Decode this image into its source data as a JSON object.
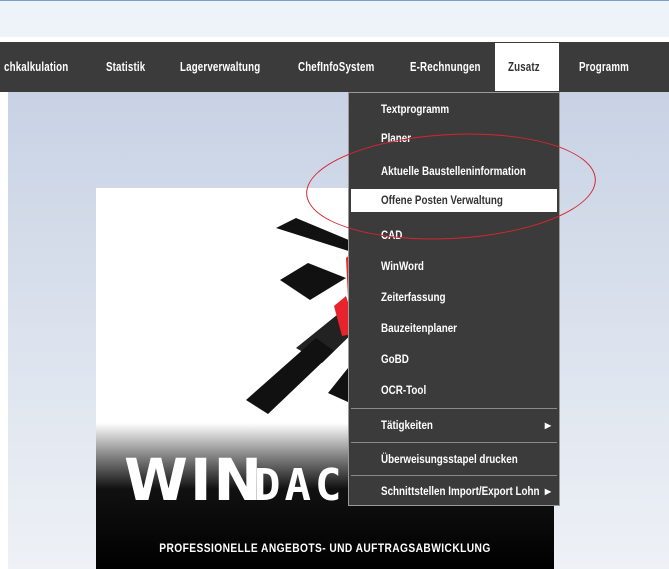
{
  "menubar": {
    "items": [
      {
        "label": "chkalkulation"
      },
      {
        "label": "Statistik"
      },
      {
        "label": "Lagerverwaltung"
      },
      {
        "label": "ChefInfoSystem"
      },
      {
        "label": "E-Rechnungen"
      },
      {
        "label": "Zusatz",
        "active": true
      },
      {
        "label": "Programm"
      }
    ]
  },
  "dropdown": {
    "items": [
      {
        "label": "Textprogramm"
      },
      {
        "label": "Planer"
      },
      {
        "label": "Aktuelle Baustelleninformation"
      },
      {
        "label": "Offene Posten Verwaltung",
        "highlighted": true
      },
      {
        "label": "CAD"
      },
      {
        "label": "WinWord"
      },
      {
        "label": "Zeiterfassung"
      },
      {
        "label": "Bauzeitenplaner"
      },
      {
        "label": "GoBD"
      },
      {
        "label": "OCR-Tool"
      },
      {
        "label": "Tätigkeiten",
        "submenu": true
      },
      {
        "label": "Überweisungsstapel drucken"
      },
      {
        "label": "Schnittstellen Import/Export Lohn",
        "submenu": true
      }
    ]
  },
  "logo": {
    "wordmark": "WINDACH2025",
    "tagline": "PROFESSIONELLE ANGEBOTS- UND AUFTRAGSABWICKLUNG"
  },
  "annotation": {
    "color": "#d6262f"
  },
  "colors": {
    "menubar": "#3b3b3b",
    "accent_red": "#e8232b"
  }
}
